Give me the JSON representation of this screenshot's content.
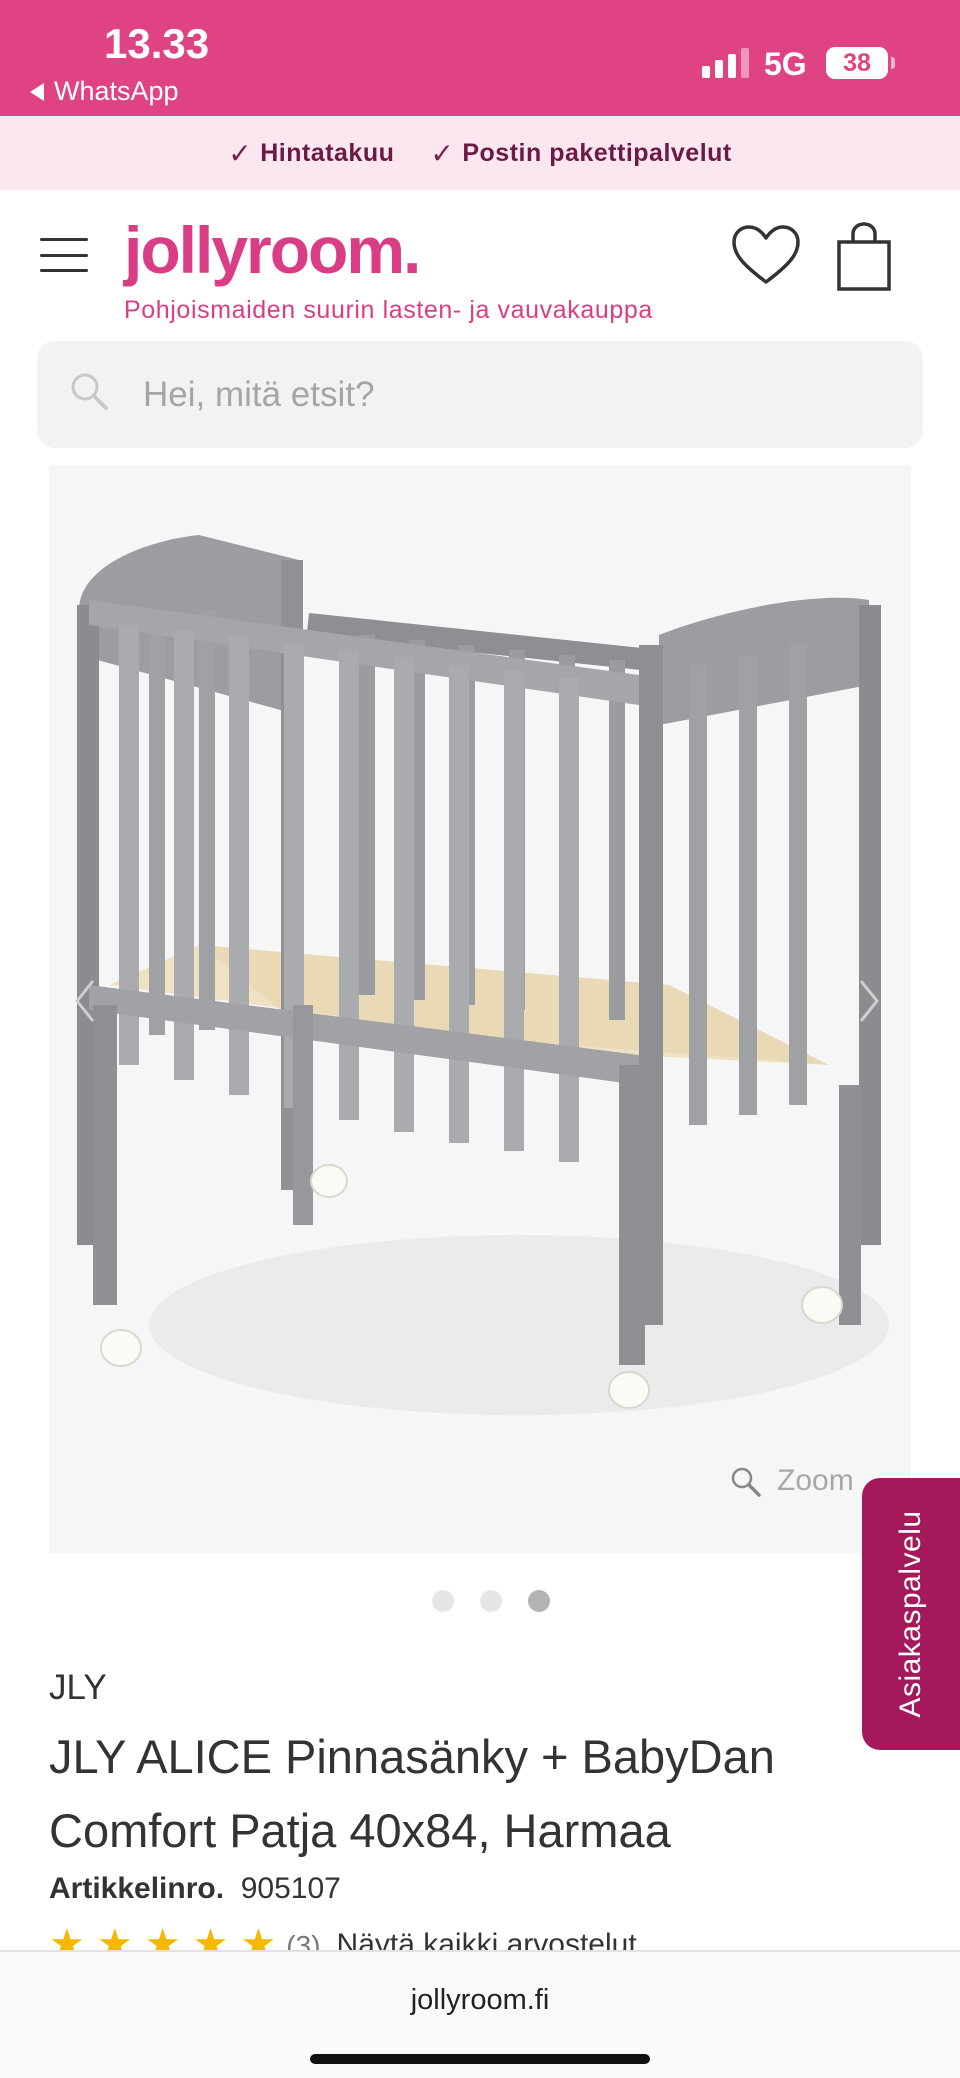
{
  "status_bar": {
    "time": "13.33",
    "back_app": "WhatsApp",
    "network": "5G",
    "battery": "38"
  },
  "usp": {
    "items": [
      "Hintatakuu",
      "Postin pakettipalvelut"
    ]
  },
  "header": {
    "logo": "jollyroom.",
    "tagline": "Pohjoismaiden suurin lasten- ja vauvakauppa"
  },
  "search": {
    "placeholder": "Hei, mitä etsit?"
  },
  "gallery": {
    "zoom_label": "Zoom",
    "image_count": 3,
    "active_index": 2
  },
  "side_tab": {
    "label": "Asiakaspalvelu"
  },
  "product": {
    "brand": "JLY",
    "title": "JLY ALICE Pinnasänky + BabyDan Comfort Patja 40x84, Harmaa",
    "sku_label": "Artikkelinro.",
    "sku_value": "905107",
    "rating_stars": 5,
    "rating_count": "(3)",
    "reviews_link": "Näytä kaikki arvostelut"
  },
  "browser": {
    "url": "jollyroom.fi"
  },
  "colors": {
    "brand_pink": "#e04383",
    "side_tab": "#a3195b",
    "usp_bg": "#fce6ef",
    "star": "#f5b800"
  }
}
